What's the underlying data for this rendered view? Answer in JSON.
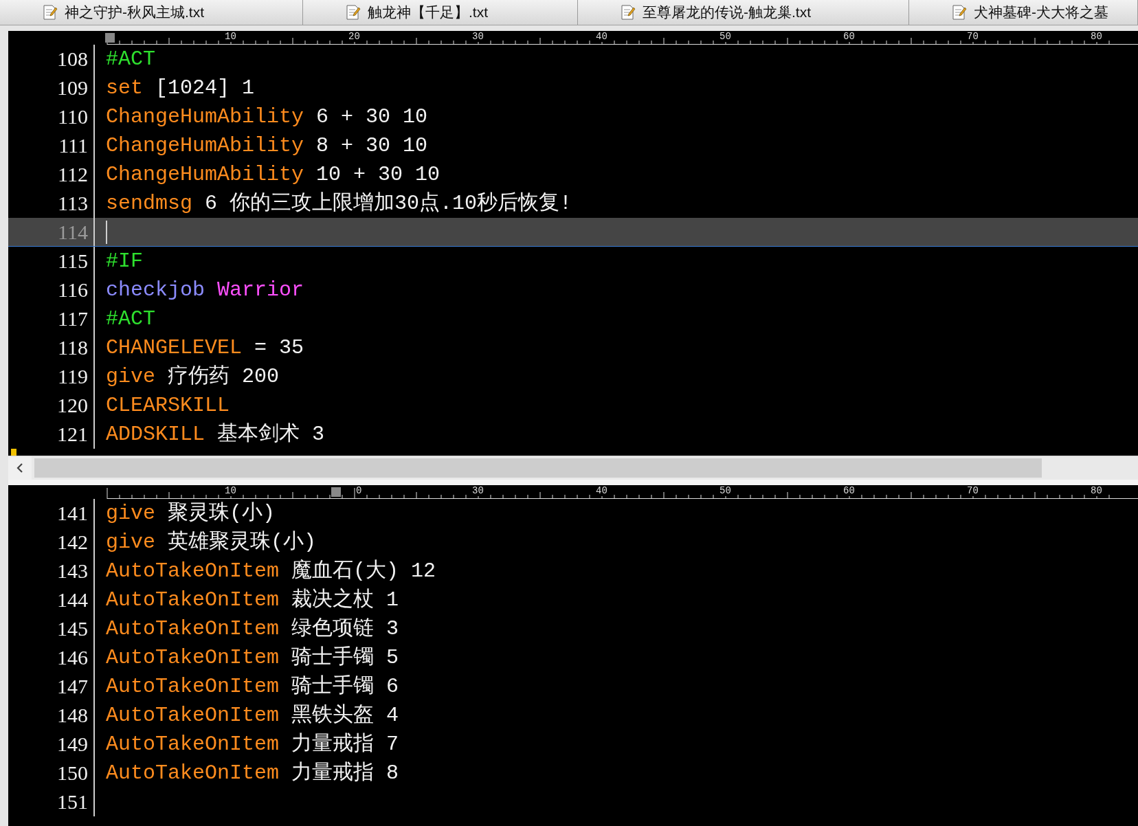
{
  "tabs": [
    {
      "label": "神之守护-秋风主城.txt",
      "selected": false
    },
    {
      "label": "触龙神【千足】.txt",
      "selected": false
    },
    {
      "label": "至尊屠龙的传说-触龙巢.txt",
      "selected": false
    },
    {
      "label": "犬神墓碑-犬大将之墓",
      "selected": false
    }
  ],
  "top_pane": {
    "ruler": [
      "10",
      "20",
      "30",
      "40",
      "50",
      "60",
      "70",
      "80"
    ],
    "lines": [
      {
        "number": "108",
        "current": false,
        "tokens": [
          {
            "text": "#ACT",
            "kind": "section"
          }
        ]
      },
      {
        "number": "109",
        "current": false,
        "tokens": [
          {
            "text": "set",
            "kind": "command"
          },
          {
            "text": " [1024] 1",
            "kind": "plain"
          }
        ]
      },
      {
        "number": "110",
        "current": false,
        "tokens": [
          {
            "text": "ChangeHumAbility",
            "kind": "command"
          },
          {
            "text": " 6 + 30 10",
            "kind": "plain"
          }
        ]
      },
      {
        "number": "111",
        "current": false,
        "tokens": [
          {
            "text": "ChangeHumAbility",
            "kind": "command"
          },
          {
            "text": " 8 + 30 10",
            "kind": "plain"
          }
        ]
      },
      {
        "number": "112",
        "current": false,
        "tokens": [
          {
            "text": "ChangeHumAbility",
            "kind": "command"
          },
          {
            "text": " 10 + 30 10",
            "kind": "plain"
          }
        ]
      },
      {
        "number": "113",
        "current": false,
        "tokens": [
          {
            "text": "sendmsg",
            "kind": "command"
          },
          {
            "text": " 6 你的三攻上限增加30点.10秒后恢复!",
            "kind": "plain"
          }
        ]
      },
      {
        "number": "114",
        "current": true
      },
      {
        "number": "115",
        "current": false,
        "tokens": [
          {
            "text": "#IF",
            "kind": "section"
          }
        ]
      },
      {
        "number": "116",
        "current": false,
        "tokens": [
          {
            "text": "checkjob",
            "kind": "condition"
          },
          {
            "text": " Warrior",
            "kind": "value"
          }
        ]
      },
      {
        "number": "117",
        "current": false,
        "tokens": [
          {
            "text": "#ACT",
            "kind": "section"
          }
        ]
      },
      {
        "number": "118",
        "current": false,
        "tokens": [
          {
            "text": "CHANGELEVEL",
            "kind": "command"
          },
          {
            "text": " = 35",
            "kind": "plain"
          }
        ]
      },
      {
        "number": "119",
        "current": false,
        "tokens": [
          {
            "text": "give",
            "kind": "command"
          },
          {
            "text": " 疗伤药 200",
            "kind": "plain"
          }
        ]
      },
      {
        "number": "120",
        "current": false,
        "tokens": [
          {
            "text": "CLEARSKILL",
            "kind": "command"
          }
        ]
      },
      {
        "number": "121",
        "current": false,
        "tokens": [
          {
            "text": "ADDSKILL",
            "kind": "command"
          },
          {
            "text": " 基本剑术 3",
            "kind": "plain"
          }
        ]
      }
    ]
  },
  "bottom_pane": {
    "ruler": [
      "10",
      "0",
      "30",
      "40",
      "50",
      "60",
      "70",
      "80"
    ],
    "lines": [
      {
        "number": "141",
        "current": false,
        "tokens": [
          {
            "text": "give",
            "kind": "command"
          },
          {
            "text": " 聚灵珠(小)",
            "kind": "plain"
          }
        ]
      },
      {
        "number": "142",
        "current": false,
        "tokens": [
          {
            "text": "give",
            "kind": "command"
          },
          {
            "text": " 英雄聚灵珠(小)",
            "kind": "plain"
          }
        ]
      },
      {
        "number": "143",
        "current": false,
        "tokens": [
          {
            "text": "AutoTakeOnItem",
            "kind": "command"
          },
          {
            "text": " 魔血石(大) 12",
            "kind": "plain"
          }
        ]
      },
      {
        "number": "144",
        "current": false,
        "tokens": [
          {
            "text": "AutoTakeOnItem",
            "kind": "command"
          },
          {
            "text": " 裁决之杖 1",
            "kind": "plain"
          }
        ]
      },
      {
        "number": "145",
        "current": false,
        "tokens": [
          {
            "text": "AutoTakeOnItem",
            "kind": "command"
          },
          {
            "text": " 绿色项链 3",
            "kind": "plain"
          }
        ]
      },
      {
        "number": "146",
        "current": false,
        "tokens": [
          {
            "text": "AutoTakeOnItem",
            "kind": "command"
          },
          {
            "text": " 骑士手镯 5",
            "kind": "plain"
          }
        ]
      },
      {
        "number": "147",
        "current": false,
        "tokens": [
          {
            "text": "AutoTakeOnItem",
            "kind": "command"
          },
          {
            "text": " 骑士手镯 6",
            "kind": "plain"
          }
        ]
      },
      {
        "number": "148",
        "current": false,
        "tokens": [
          {
            "text": "AutoTakeOnItem",
            "kind": "command"
          },
          {
            "text": " 黑铁头盔 4",
            "kind": "plain"
          }
        ]
      },
      {
        "number": "149",
        "current": false,
        "tokens": [
          {
            "text": "AutoTakeOnItem",
            "kind": "command"
          },
          {
            "text": " 力量戒指 7",
            "kind": "plain"
          }
        ]
      },
      {
        "number": "150",
        "current": false,
        "tokens": [
          {
            "text": "AutoTakeOnItem",
            "kind": "command"
          },
          {
            "text": " 力量戒指 8",
            "kind": "plain"
          }
        ]
      },
      {
        "number": "151",
        "current": false
      }
    ]
  }
}
